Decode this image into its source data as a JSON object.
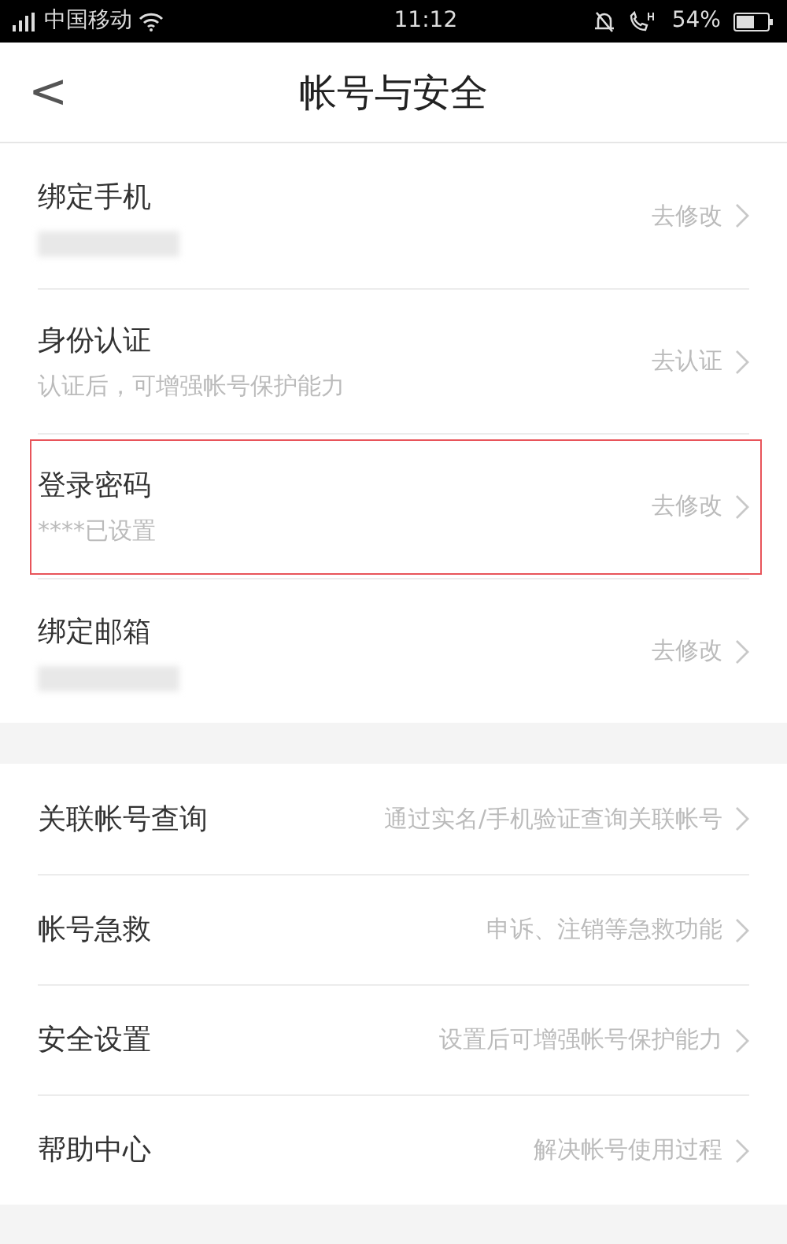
{
  "status_bar": {
    "carrier": "中国移动",
    "time": "11:12",
    "battery": "54%"
  },
  "header": {
    "back": "<",
    "title": "帐号与安全"
  },
  "groups": [
    {
      "items": [
        {
          "title": "绑定手机",
          "masked": true,
          "action": "去修改",
          "highlighted": false
        },
        {
          "title": "身份认证",
          "subtitle": "认证后，可增强帐号保护能力",
          "action": "去认证",
          "highlighted": false
        },
        {
          "title": "登录密码",
          "subtitle": "****已设置",
          "action": "去修改",
          "highlighted": true
        },
        {
          "title": "绑定邮箱",
          "masked": true,
          "action": "去修改",
          "highlighted": false
        }
      ]
    },
    {
      "items": [
        {
          "title": "关联帐号查询",
          "action": "通过实名/手机验证查询关联帐号",
          "highlighted": false
        },
        {
          "title": "帐号急救",
          "action": "申诉、注销等急救功能",
          "highlighted": false
        },
        {
          "title": "安全设置",
          "action": "设置后可增强帐号保护能力",
          "highlighted": false
        },
        {
          "title": "帮助中心",
          "action": "解决帐号使用过程",
          "highlighted": false
        }
      ]
    }
  ]
}
